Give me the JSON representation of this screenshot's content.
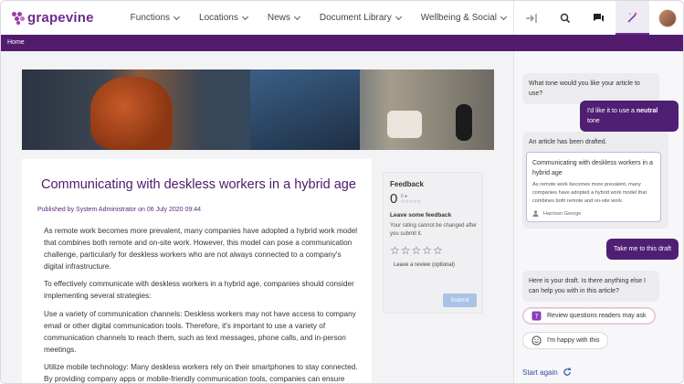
{
  "app": {
    "brand": "grapevine",
    "brand_color": "#6b2c8f",
    "accent_color": "#521b6e"
  },
  "nav": {
    "items": [
      {
        "label": "Functions"
      },
      {
        "label": "Locations"
      },
      {
        "label": "News"
      },
      {
        "label": "Document Library"
      },
      {
        "label": "Wellbeing & Social"
      }
    ]
  },
  "toolbar": {
    "icons": [
      "collapse-panel-icon",
      "search-icon",
      "chat-icon",
      "magic-wand-icon"
    ],
    "active": "magic-wand-icon"
  },
  "breadcrumb": {
    "home": "Home"
  },
  "article": {
    "title": "Communicating with deskless workers in a hybrid age",
    "byline": "Published by System Administrator on 06 July 2020 09:44",
    "paragraphs": [
      "As remote work becomes more prevalent, many companies have adopted a hybrid work model that combines both remote and on-site work. However, this model can pose a communication challenge, particularly for deskless workers who are not always connected to a company's digital infrastructure.",
      "To effectively communicate with deskless workers in a hybrid age, companies should consider implementing several strategies:",
      "Use a variety of communication channels: Deskless workers may not have access to company email or other digital communication tools. Therefore, it's important to use a variety of communication channels to reach them, such as text messages, phone calls, and in-person meetings.",
      "Utilize mobile technology: Many deskless workers rely on their smartphones to stay connected. By providing company apps or mobile-friendly communication tools, companies can ensure that deskless workers have access to important information and can"
    ]
  },
  "feedback": {
    "title": "Feedback",
    "score": "0",
    "mini_score": "0",
    "mini_user_icon": "user-icon",
    "leave_heading": "Leave some feedback",
    "note": "Your rating cannot be changed after you submit it.",
    "stars": 5,
    "review_link": "Leave a review (optional)",
    "submit": "Submit"
  },
  "chat": {
    "q_tone": "What tone would you like your article to use?",
    "a_tone_prefix": "I'd like it to use a ",
    "a_tone_bold": "neutral",
    "a_tone_suffix": " tone",
    "drafted": "An article has been drafted.",
    "draft": {
      "title": "Communicating with deskless workers in a hybrid age",
      "body": "As remote work becomes more prevalent, many companies have adopted a hybrid work model that combines both remote and on-site work.",
      "author": "Harrison George"
    },
    "take_me": "Take me to this draft",
    "here_is": "Here is your draft. Is there anything else I can help you with in this article?",
    "suggestion_1": "Review questions readers may ask",
    "suggestion_2": "I'm happy with this",
    "start_again": "Start again"
  }
}
